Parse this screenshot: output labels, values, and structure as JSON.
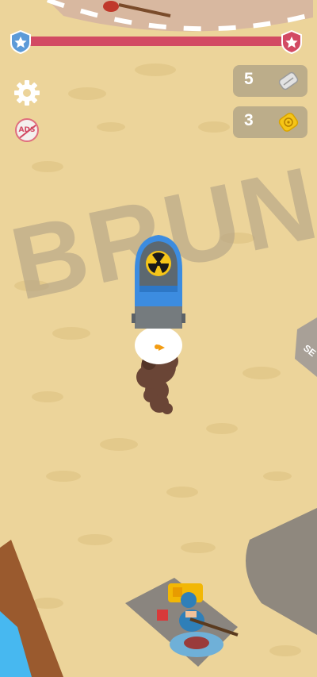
{
  "hud": {
    "progress_fraction": 1.0,
    "bar_color": "#d24a63",
    "badge_color": "#5b9ad8",
    "badge_right_color": "#d24a63"
  },
  "buttons": {
    "settings_icon": "gear-icon",
    "ads_label": "ADS"
  },
  "resources": {
    "bullets_count": "5",
    "bullets_icon": "silver-bullets-icon",
    "nuclear_count": "3",
    "nuclear_icon": "yellow-nuclear-canister-icon"
  },
  "scene": {
    "ground_text": "BRUN",
    "sign_text": "SE",
    "colors": {
      "sand": "#ecd49a",
      "ground_text": "#b9a888",
      "rocket_nose": "#3c8ce0",
      "rocket_body": "#5c6870",
      "radiation": "#f5c518",
      "smoke": "#6a4536",
      "water": "#47b8f0",
      "crate": "#f2b705"
    }
  }
}
